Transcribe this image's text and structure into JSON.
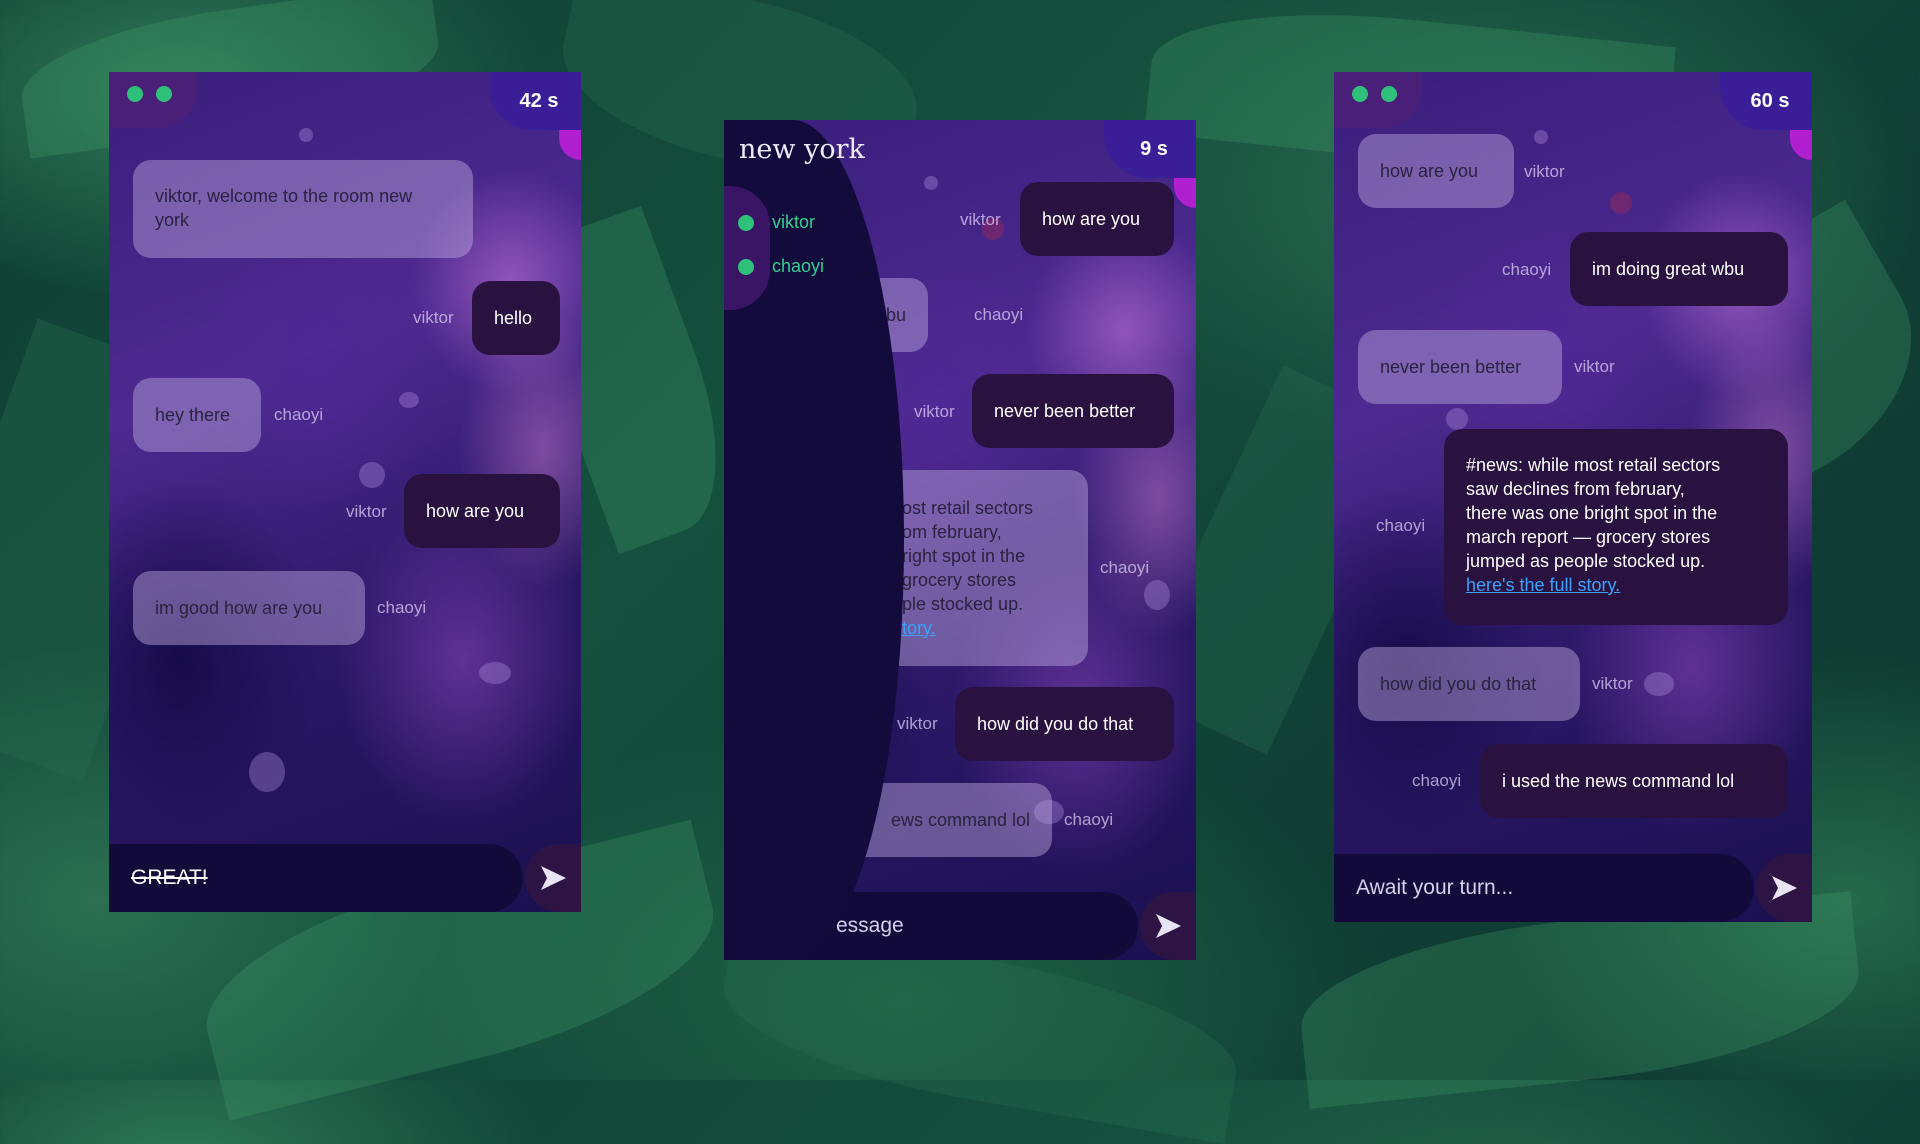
{
  "colors": {
    "online": "#2fc07a",
    "timer": "#3a1e98",
    "link": "#3aa3ff"
  },
  "left": {
    "timer": "42 s",
    "messages": [
      {
        "from": "system",
        "text": "viktor, welcome to the room new york"
      },
      {
        "from": "viktor",
        "text": "hello"
      },
      {
        "from": "chaoyi",
        "text": "hey there"
      },
      {
        "from": "viktor",
        "text": "how are you"
      },
      {
        "from": "chaoyi",
        "text": "im good how are you"
      }
    ],
    "names": {
      "viktor": "viktor",
      "chaoyi": "chaoyi"
    },
    "input_value": "GREAT!"
  },
  "middle": {
    "room_title": "new york",
    "timer": "9 s",
    "users": [
      "viktor",
      "chaoyi"
    ],
    "messages": [
      {
        "from": "viktor",
        "text": "how are you"
      },
      {
        "from": "chaoyi",
        "text": "wbu"
      },
      {
        "from": "viktor",
        "text": "never been better"
      },
      {
        "from": "chaoyi",
        "lines": [
          "ost retail sectors",
          "om february,",
          "right spot in the",
          "grocery stores",
          "ple stocked up."
        ],
        "link": "tory."
      },
      {
        "from": "viktor",
        "text": "how did you do that"
      },
      {
        "from": "chaoyi",
        "text": "ews command lol"
      }
    ],
    "names": {
      "viktor": "viktor",
      "chaoyi": "chaoyi"
    },
    "input_placeholder": "essage"
  },
  "right": {
    "timer": "60 s",
    "messages": [
      {
        "from": "viktor",
        "text": "how are you"
      },
      {
        "from": "chaoyi",
        "text": "im doing great wbu"
      },
      {
        "from": "viktor",
        "text": "never been better"
      },
      {
        "from": "chaoyi",
        "lines": [
          "#news: while most retail sectors",
          "saw declines from february,",
          "there was one bright spot in the",
          "march report — grocery stores",
          "jumped as people stocked up."
        ],
        "link": "here's the full story."
      },
      {
        "from": "viktor",
        "text": "how did you do that"
      },
      {
        "from": "chaoyi",
        "text": "i used the news command lol"
      }
    ],
    "names": {
      "viktor": "viktor",
      "chaoyi": "chaoyi"
    },
    "input_placeholder": "Await your turn..."
  },
  "icons": {
    "send": "send-arrow-icon",
    "status": "online-dot-icon"
  }
}
